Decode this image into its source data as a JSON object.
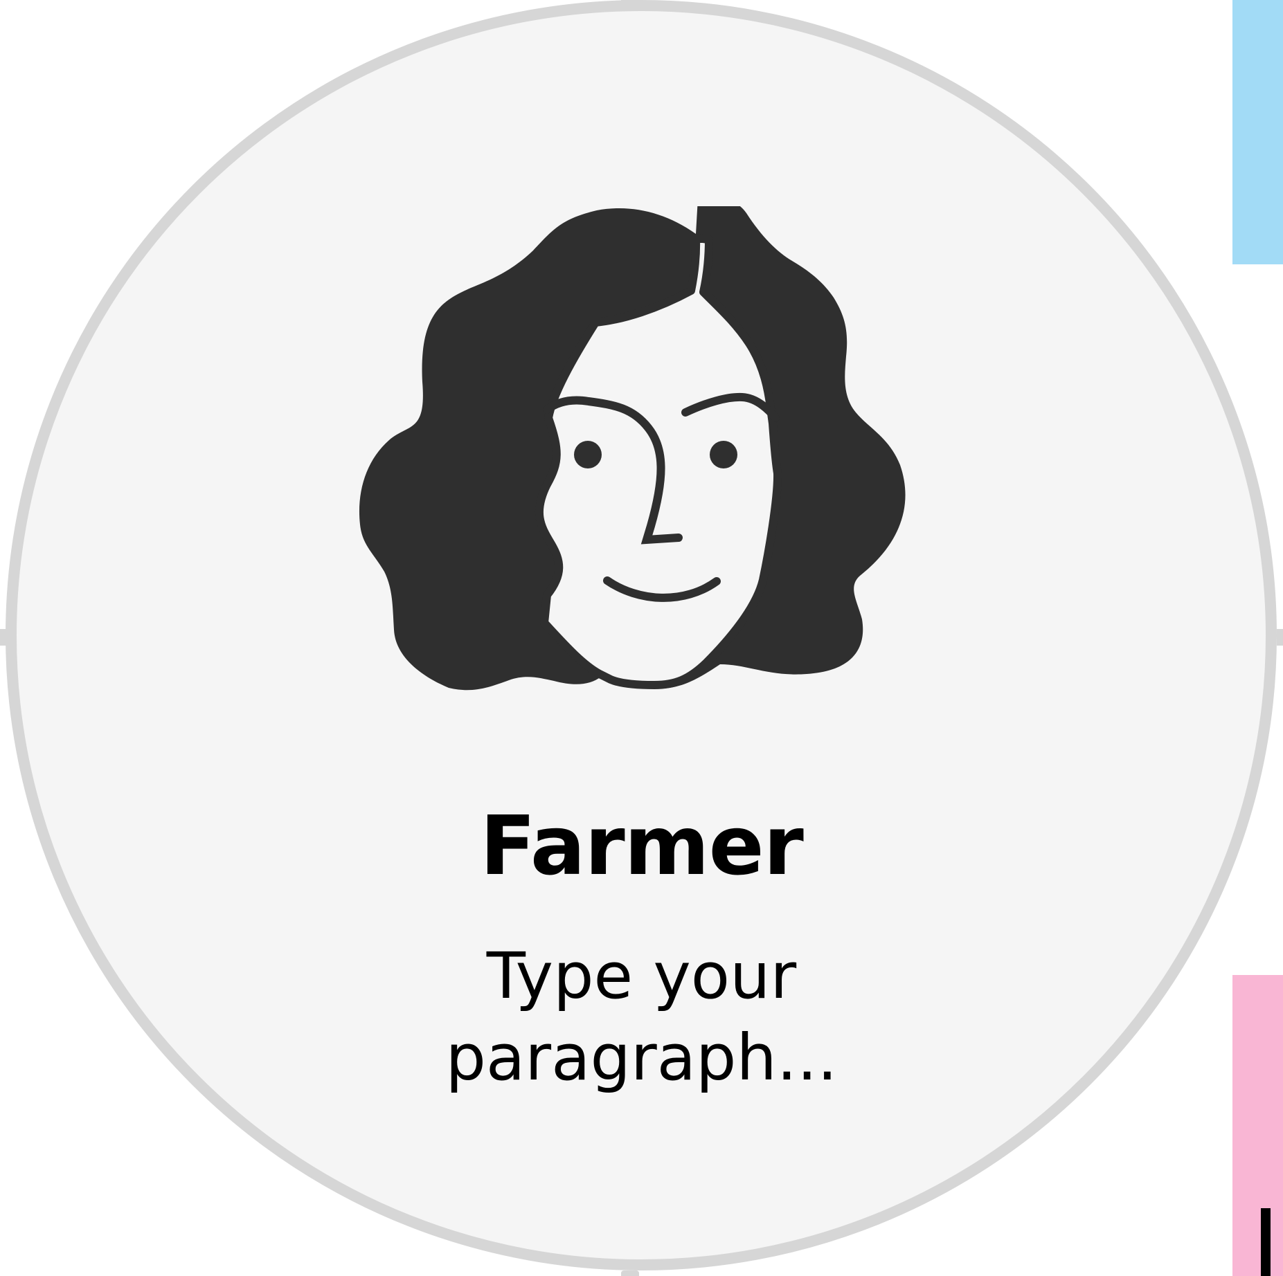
{
  "card": {
    "title": "Farmer",
    "paragraph": "Type your paragraph..."
  },
  "avatar": {
    "icon": "woman-with-wavy-hair-face",
    "ink_color": "#2f2f2f",
    "background_color": "#f5f5f5"
  },
  "colors": {
    "card_fill": "#f5f5f5",
    "card_border": "#d6d6d6",
    "side_strip_top": "#a2dbf6",
    "side_strip_bottom": "#f9b6d4"
  }
}
